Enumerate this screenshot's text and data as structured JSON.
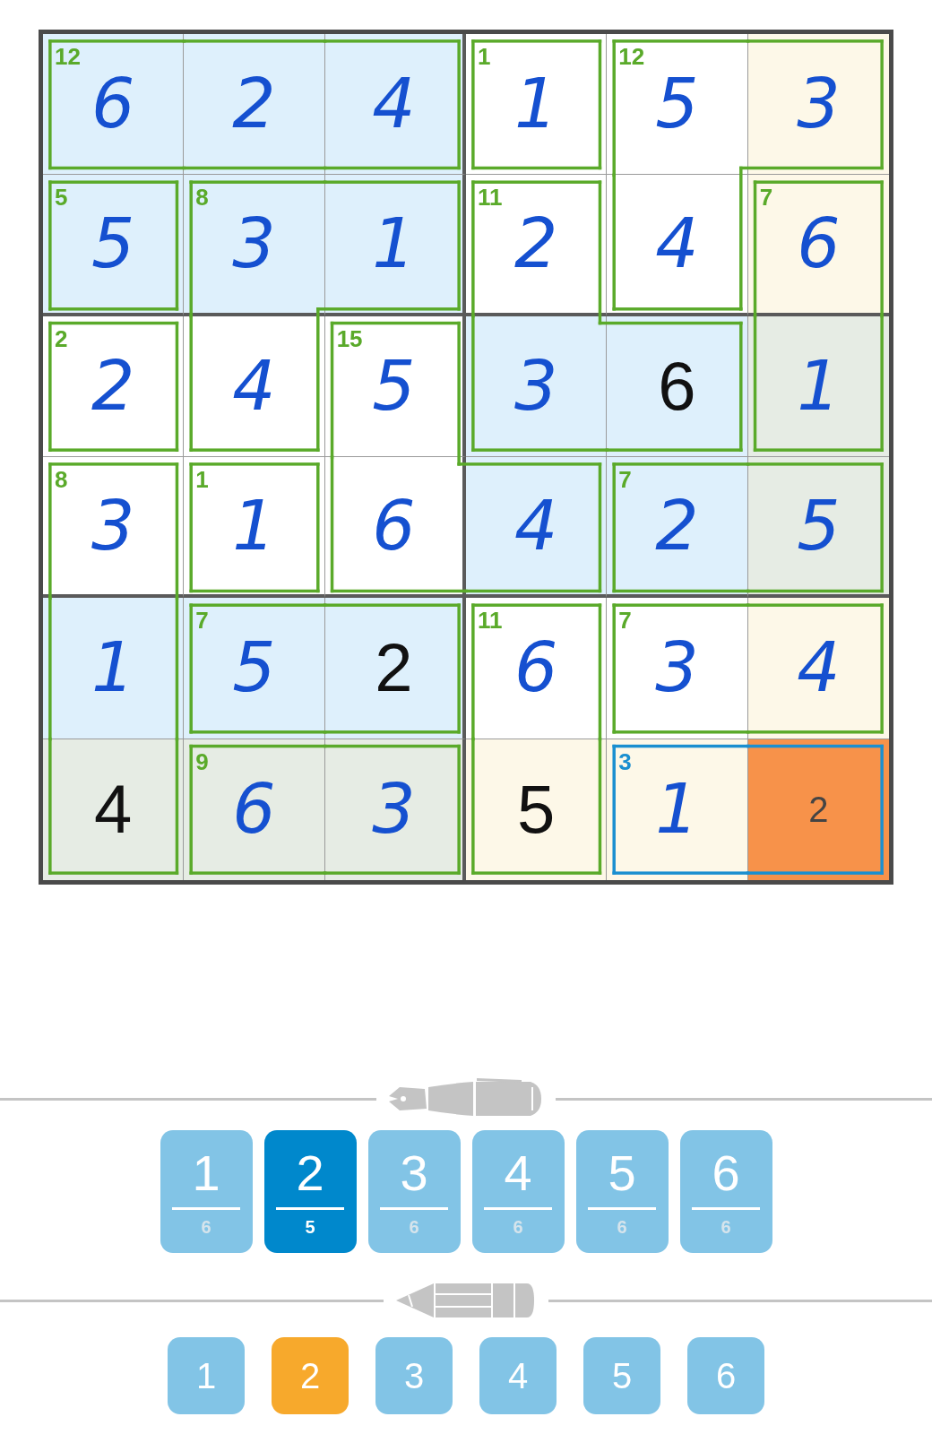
{
  "grid": {
    "rows": [
      {
        "cells": [
          {
            "value": "6",
            "kind": "entered",
            "color": "#def0fc",
            "selected": false,
            "cage": {
              "sum": "12",
              "color": "#5aaa2a",
              "top": true,
              "right": false,
              "bottom": true,
              "left": true
            }
          },
          {
            "value": "2",
            "kind": "entered",
            "color": "#def0fc",
            "selected": false,
            "cage": {
              "color": "#5aaa2a",
              "top": true,
              "right": false,
              "bottom": true,
              "left": false
            }
          },
          {
            "value": "4",
            "kind": "entered",
            "color": "#def0fc",
            "selected": false,
            "cage": {
              "color": "#5aaa2a",
              "top": true,
              "right": true,
              "bottom": true,
              "left": false
            }
          },
          {
            "value": "1",
            "kind": "entered",
            "color": "#ffffff",
            "selected": false,
            "cage": {
              "sum": "1",
              "color": "#5aaa2a",
              "top": true,
              "right": true,
              "bottom": true,
              "left": true
            }
          },
          {
            "value": "5",
            "kind": "entered",
            "color": "#ffffff",
            "selected": false,
            "cage": {
              "sum": "12",
              "color": "#5aaa2a",
              "top": true,
              "right": false,
              "bottom": false,
              "left": true
            }
          },
          {
            "value": "3",
            "kind": "entered",
            "color": "#fdf8e8",
            "selected": false,
            "cage": {
              "color": "#5aaa2a",
              "top": true,
              "right": true,
              "bottom": true,
              "left": false
            }
          }
        ]
      },
      {
        "cells": [
          {
            "value": "5",
            "kind": "entered",
            "color": "#def0fc",
            "selected": false,
            "cage": {
              "sum": "5",
              "color": "#5aaa2a",
              "top": true,
              "right": true,
              "bottom": true,
              "left": true
            }
          },
          {
            "value": "3",
            "kind": "entered",
            "color": "#def0fc",
            "selected": false,
            "cage": {
              "sum": "8",
              "color": "#5aaa2a",
              "top": true,
              "right": false,
              "bottom": false,
              "left": true
            }
          },
          {
            "value": "1",
            "kind": "entered",
            "color": "#def0fc",
            "selected": false,
            "cage": {
              "color": "#5aaa2a",
              "top": true,
              "right": true,
              "bottom": true,
              "left": false
            }
          },
          {
            "value": "2",
            "kind": "entered",
            "color": "#ffffff",
            "selected": false,
            "cage": {
              "sum": "11",
              "color": "#5aaa2a",
              "top": true,
              "right": true,
              "bottom": false,
              "left": true
            }
          },
          {
            "value": "4",
            "kind": "entered",
            "color": "#ffffff",
            "selected": false,
            "cage": {
              "color": "#5aaa2a",
              "top": false,
              "right": true,
              "bottom": true,
              "left": true
            }
          },
          {
            "value": "6",
            "kind": "entered",
            "color": "#fdf8e8",
            "selected": false,
            "cage": {
              "sum": "7",
              "color": "#5aaa2a",
              "top": true,
              "right": true,
              "bottom": false,
              "left": true
            }
          }
        ]
      },
      {
        "cells": [
          {
            "value": "2",
            "kind": "entered",
            "color": "#ffffff",
            "selected": false,
            "cage": {
              "sum": "2",
              "color": "#5aaa2a",
              "top": true,
              "right": true,
              "bottom": true,
              "left": true
            }
          },
          {
            "value": "4",
            "kind": "entered",
            "color": "#ffffff",
            "selected": false,
            "cage": {
              "color": "#5aaa2a",
              "top": false,
              "right": true,
              "bottom": true,
              "left": true
            }
          },
          {
            "value": "5",
            "kind": "entered",
            "color": "#ffffff",
            "selected": false,
            "cage": {
              "sum": "15",
              "color": "#5aaa2a",
              "top": true,
              "right": true,
              "bottom": false,
              "left": true
            }
          },
          {
            "value": "3",
            "kind": "entered",
            "color": "#def0fc",
            "selected": false,
            "cage": {
              "color": "#5aaa2a",
              "top": false,
              "right": false,
              "bottom": true,
              "left": true
            }
          },
          {
            "value": "6",
            "kind": "given",
            "color": "#def0fc",
            "selected": false,
            "cage": {
              "color": "#5aaa2a",
              "top": true,
              "right": true,
              "bottom": true,
              "left": false
            }
          },
          {
            "value": "1",
            "kind": "entered",
            "color": "#e6ece4",
            "selected": false,
            "cage": {
              "color": "#5aaa2a",
              "top": false,
              "right": true,
              "bottom": true,
              "left": true
            }
          }
        ]
      },
      {
        "cells": [
          {
            "value": "3",
            "kind": "entered",
            "color": "#ffffff",
            "selected": false,
            "cage": {
              "sum": "8",
              "color": "#5aaa2a",
              "top": true,
              "right": true,
              "bottom": false,
              "left": true
            }
          },
          {
            "value": "1",
            "kind": "entered",
            "color": "#ffffff",
            "selected": false,
            "cage": {
              "sum": "1",
              "color": "#5aaa2a",
              "top": true,
              "right": true,
              "bottom": true,
              "left": true
            }
          },
          {
            "value": "6",
            "kind": "entered",
            "color": "#ffffff",
            "selected": false,
            "cage": {
              "color": "#5aaa2a",
              "top": false,
              "right": false,
              "bottom": true,
              "left": true
            }
          },
          {
            "value": "4",
            "kind": "entered",
            "color": "#def0fc",
            "selected": false,
            "cage": {
              "color": "#5aaa2a",
              "top": true,
              "right": true,
              "bottom": true,
              "left": false
            }
          },
          {
            "value": "2",
            "kind": "entered",
            "color": "#def0fc",
            "selected": false,
            "cage": {
              "sum": "7",
              "color": "#5aaa2a",
              "top": true,
              "right": false,
              "bottom": true,
              "left": true
            }
          },
          {
            "value": "5",
            "kind": "entered",
            "color": "#e6ece4",
            "selected": false,
            "cage": {
              "color": "#5aaa2a",
              "top": true,
              "right": true,
              "bottom": true,
              "left": false
            }
          }
        ]
      },
      {
        "cells": [
          {
            "value": "1",
            "kind": "entered",
            "color": "#def0fc",
            "selected": false,
            "cage": {
              "color": "#5aaa2a",
              "top": false,
              "right": true,
              "bottom": false,
              "left": true
            }
          },
          {
            "value": "5",
            "kind": "entered",
            "color": "#def0fc",
            "selected": false,
            "cage": {
              "sum": "7",
              "color": "#5aaa2a",
              "top": true,
              "right": false,
              "bottom": true,
              "left": true
            }
          },
          {
            "value": "2",
            "kind": "given",
            "color": "#def0fc",
            "selected": false,
            "cage": {
              "color": "#5aaa2a",
              "top": true,
              "right": true,
              "bottom": true,
              "left": false
            }
          },
          {
            "value": "6",
            "kind": "entered",
            "color": "#ffffff",
            "selected": false,
            "cage": {
              "sum": "11",
              "color": "#5aaa2a",
              "top": true,
              "right": true,
              "bottom": false,
              "left": true
            }
          },
          {
            "value": "3",
            "kind": "entered",
            "color": "#ffffff",
            "selected": false,
            "cage": {
              "sum": "7",
              "color": "#5aaa2a",
              "top": true,
              "right": false,
              "bottom": true,
              "left": true
            }
          },
          {
            "value": "4",
            "kind": "entered",
            "color": "#fdf8e8",
            "selected": false,
            "cage": {
              "color": "#5aaa2a",
              "top": true,
              "right": true,
              "bottom": true,
              "left": false
            }
          }
        ]
      },
      {
        "cells": [
          {
            "value": "4",
            "kind": "given",
            "color": "#e6ece4",
            "selected": false,
            "cage": {
              "color": "#5aaa2a",
              "top": false,
              "right": true,
              "bottom": true,
              "left": true
            }
          },
          {
            "value": "6",
            "kind": "entered",
            "color": "#e6ece4",
            "selected": false,
            "cage": {
              "sum": "9",
              "color": "#5aaa2a",
              "top": true,
              "right": false,
              "bottom": true,
              "left": true
            }
          },
          {
            "value": "3",
            "kind": "entered",
            "color": "#e6ece4",
            "selected": false,
            "cage": {
              "color": "#5aaa2a",
              "top": true,
              "right": true,
              "bottom": true,
              "left": false
            }
          },
          {
            "value": "5",
            "kind": "given",
            "color": "#fdf8e8",
            "selected": false,
            "cage": {
              "color": "#5aaa2a",
              "top": false,
              "right": true,
              "bottom": true,
              "left": true
            }
          },
          {
            "value": "1",
            "kind": "entered",
            "color": "#fdf8e8",
            "selected": false,
            "cage": {
              "sum": "3",
              "color": "#1a8fd0",
              "top": true,
              "right": false,
              "bottom": true,
              "left": true
            }
          },
          {
            "value": "2",
            "kind": "note",
            "selected": true,
            "cage": {
              "color": "#1a8fd0",
              "top": true,
              "right": true,
              "bottom": true,
              "left": false
            }
          }
        ]
      }
    ]
  },
  "pen": {
    "digits": [
      {
        "label": "1",
        "count": "6",
        "selected": false
      },
      {
        "label": "2",
        "count": "5",
        "selected": true
      },
      {
        "label": "3",
        "count": "6",
        "selected": false
      },
      {
        "label": "4",
        "count": "6",
        "selected": false
      },
      {
        "label": "5",
        "count": "6",
        "selected": false
      },
      {
        "label": "6",
        "count": "6",
        "selected": false
      }
    ]
  },
  "pencil": {
    "digits": [
      {
        "label": "1",
        "selected": false
      },
      {
        "label": "2",
        "selected": true
      },
      {
        "label": "3",
        "selected": false
      },
      {
        "label": "4",
        "selected": false
      },
      {
        "label": "5",
        "selected": false
      },
      {
        "label": "6",
        "selected": false
      }
    ]
  }
}
